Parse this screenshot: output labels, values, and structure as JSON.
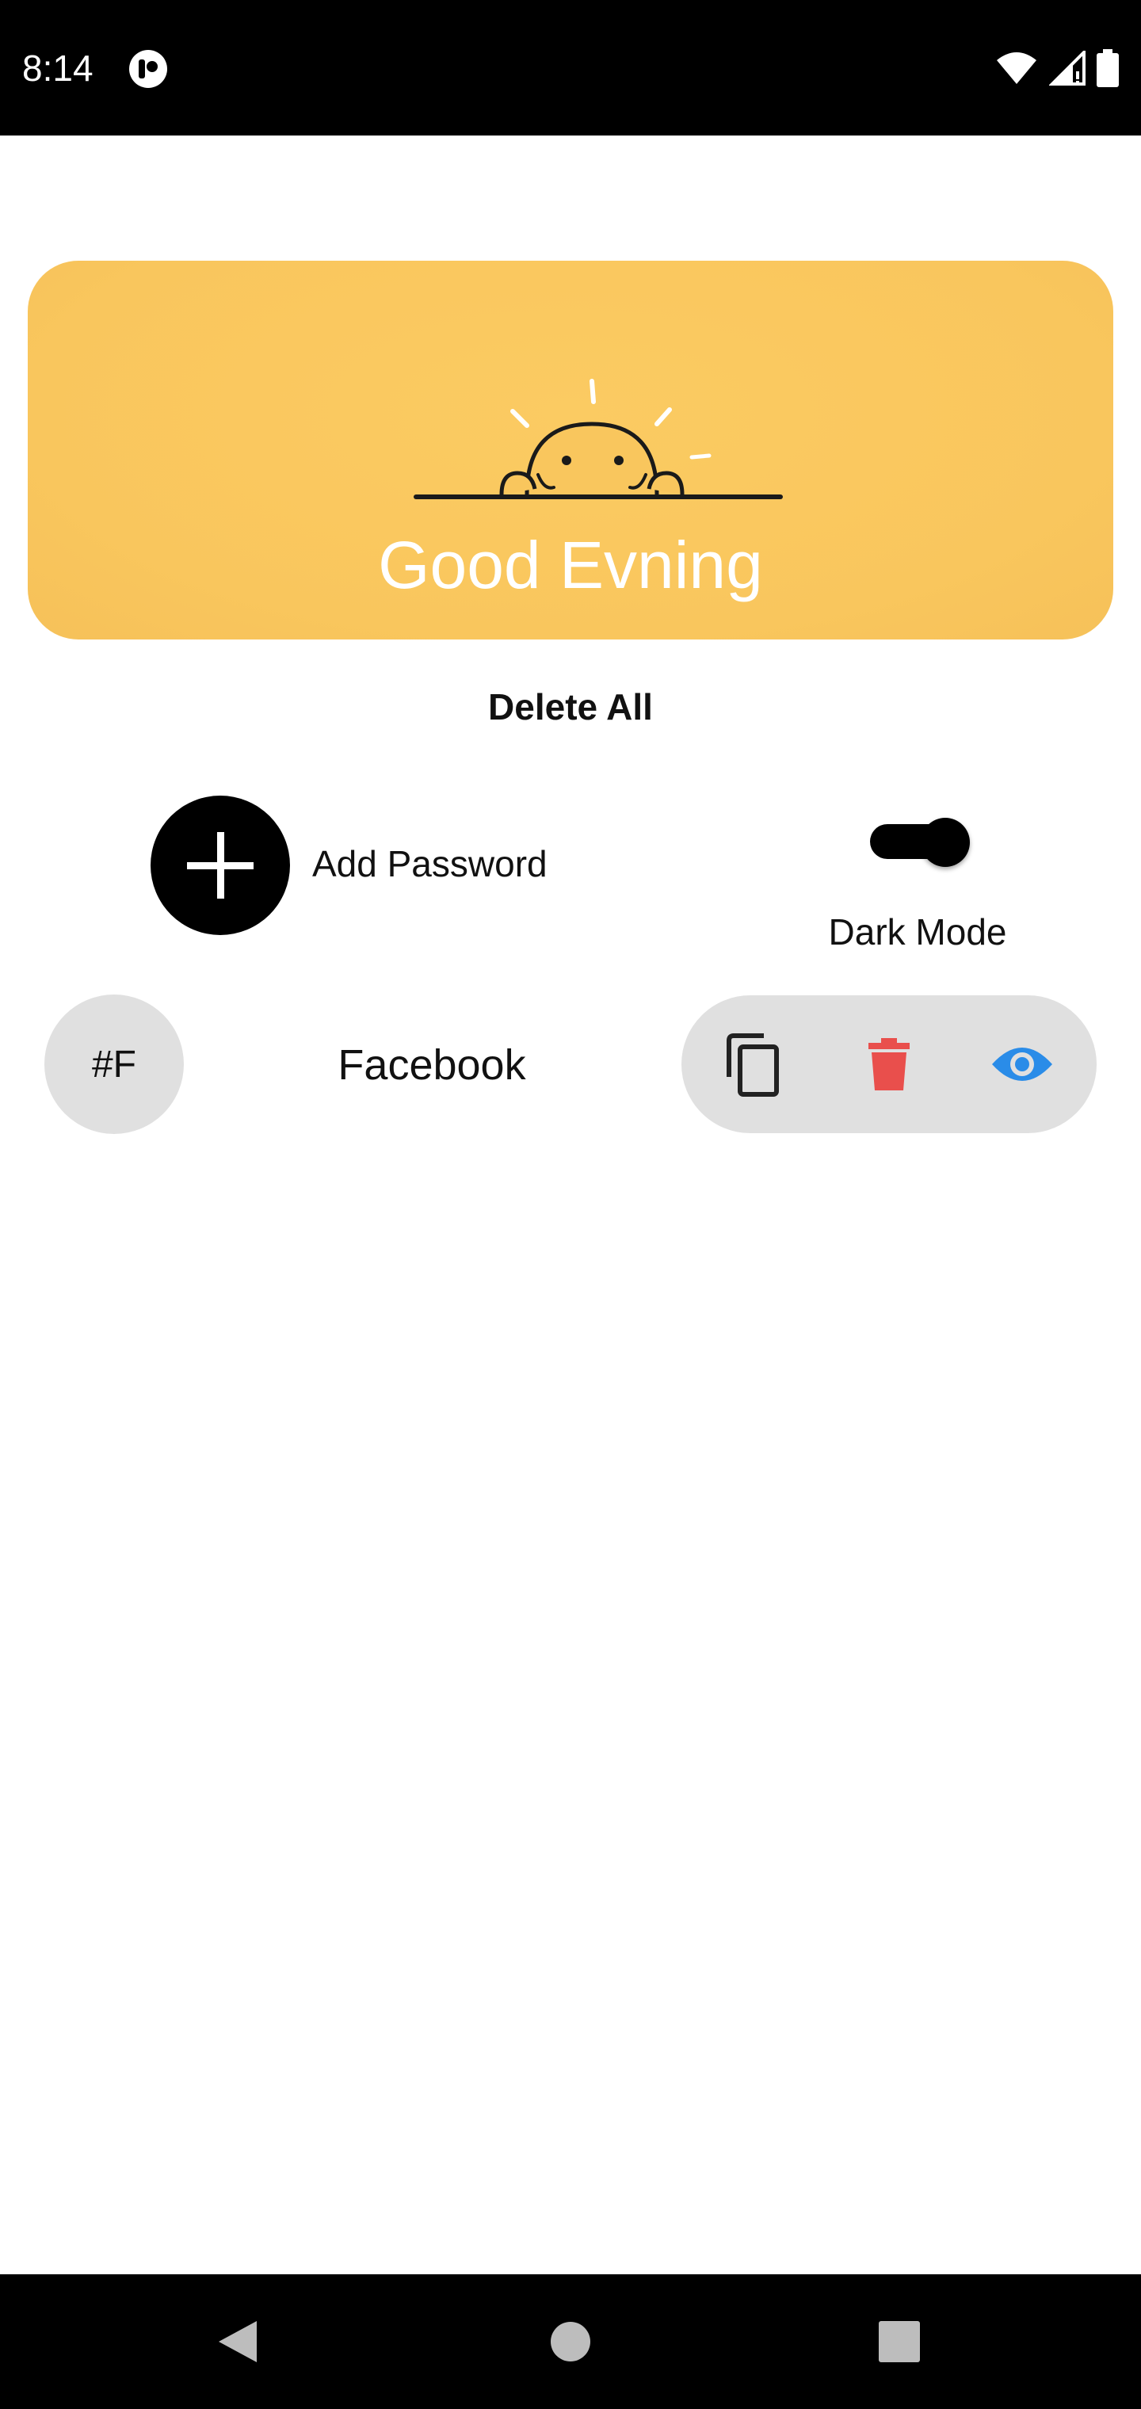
{
  "status_bar": {
    "time": "8:14",
    "app_icon": "notification-app-icon",
    "icons": [
      "wifi-icon",
      "cell-signal-icon",
      "battery-icon"
    ]
  },
  "banner": {
    "greeting": "Good Evning",
    "illustration": "peeking-sun-illustration",
    "background_color": "#F9C75F"
  },
  "actions": {
    "delete_all_label": "Delete All",
    "add_password_label": "Add Password",
    "add_icon": "plus-icon",
    "dark_mode_label": "Dark Mode",
    "dark_mode_on": true
  },
  "entries": [
    {
      "avatar_text": "#F",
      "name": "Facebook",
      "buttons": [
        {
          "icon": "copy-icon",
          "color": "#222222"
        },
        {
          "icon": "trash-icon",
          "color": "#E94F4C"
        },
        {
          "icon": "eye-icon",
          "color": "#2A8CE8"
        }
      ]
    }
  ],
  "nav_bar": {
    "buttons": [
      "back-icon",
      "home-icon",
      "recents-icon"
    ]
  }
}
